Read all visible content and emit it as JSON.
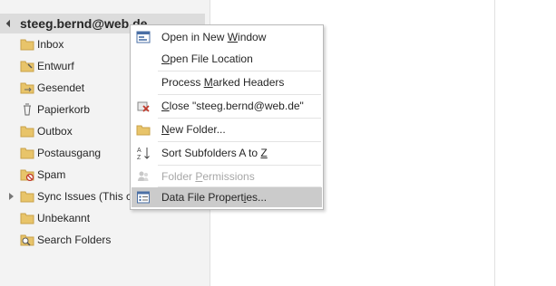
{
  "account": {
    "name": "steeg.bernd@web.de"
  },
  "folders": [
    {
      "label": "Inbox",
      "icon": "folder-icon",
      "expandable": false
    },
    {
      "label": "Entwurf",
      "icon": "drafts-folder-icon",
      "expandable": false
    },
    {
      "label": "Gesendet",
      "icon": "sent-folder-icon",
      "expandable": false
    },
    {
      "label": "Papierkorb",
      "icon": "trash-icon",
      "expandable": false
    },
    {
      "label": "Outbox",
      "icon": "outbox-folder-icon",
      "expandable": false
    },
    {
      "label": "Postausgang",
      "icon": "folder-icon",
      "expandable": false
    },
    {
      "label": "Spam",
      "icon": "junk-folder-icon",
      "expandable": false
    },
    {
      "label": "Sync Issues (This co",
      "icon": "folder-icon",
      "expandable": true
    },
    {
      "label": "Unbekannt",
      "icon": "folder-icon",
      "expandable": false
    },
    {
      "label": "Search Folders",
      "icon": "search-folder-icon",
      "expandable": false
    }
  ],
  "context_menu": {
    "items": [
      {
        "pre": "Open in New ",
        "ul": "W",
        "post": "indow",
        "icon": "new-window-icon",
        "disabled": false,
        "highlighted": false
      },
      {
        "pre": "",
        "ul": "O",
        "post": "pen File Location",
        "icon": "none",
        "disabled": false,
        "highlighted": false
      },
      {
        "pre": "Process ",
        "ul": "M",
        "post": "arked Headers",
        "icon": "none",
        "disabled": false,
        "highlighted": false
      },
      {
        "pre": "",
        "ul": "C",
        "post": "lose \"steeg.bernd@web.de\"",
        "icon": "close-data-file-icon",
        "disabled": false,
        "highlighted": false
      },
      {
        "pre": "",
        "ul": "N",
        "post": "ew Folder...",
        "icon": "new-folder-icon",
        "disabled": false,
        "highlighted": false
      },
      {
        "pre": "Sort Subfolders A to ",
        "ul": "Z",
        "post": "",
        "icon": "sort-az-icon",
        "disabled": false,
        "highlighted": false
      },
      {
        "pre": "Folder ",
        "ul": "P",
        "post": "ermissions",
        "icon": "folder-permissions-icon",
        "disabled": true,
        "highlighted": false
      },
      {
        "pre": "Data File Propert",
        "ul": "i",
        "post": "es...",
        "icon": "properties-icon",
        "disabled": false,
        "highlighted": true
      }
    ]
  },
  "colors": {
    "folder_yellow": "#e8c46a",
    "highlight": "#cbcbcb",
    "header_bg": "#dcdcdc",
    "pane_bg": "#f3f3f3"
  }
}
